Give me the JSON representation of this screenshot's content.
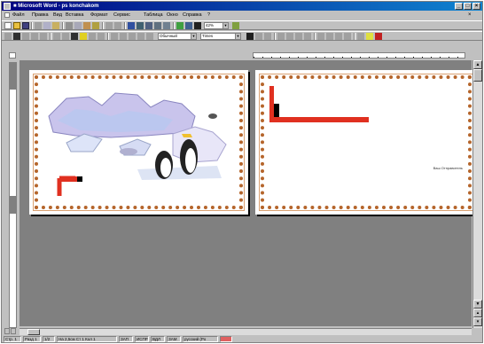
{
  "window": {
    "title": "■ Microsoft Word - ps konchakom"
  },
  "menubar": {
    "items": [
      "Файл",
      "Правка",
      "Вид",
      "Вставка",
      "Формат",
      "Сервис",
      "Таблица",
      "Окно",
      "Справка",
      "?"
    ]
  },
  "toolbar2": {
    "zoom_value": "42%"
  },
  "toolbar3": {
    "style_value": "Обычный",
    "font_value": "Times"
  },
  "page2": {
    "signature": "Ваш Отправитель"
  },
  "statusbar": {
    "cells": [
      "Стр. 1",
      "Разд 1",
      "1/2",
      "На 2,5см Ст 1 Кол 1",
      "ЗАП",
      "ИСПР",
      "ВДЛ",
      "ЗАМ",
      "русский (Ро"
    ]
  },
  "colors": {
    "title_bar": "#000080",
    "workspace": "#808080",
    "page_border": "#b5652b",
    "accent_red": "#e03020"
  }
}
